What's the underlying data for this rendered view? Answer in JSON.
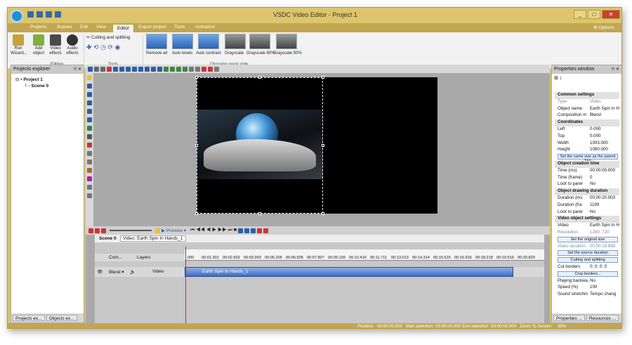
{
  "app": {
    "title": "VSDC Video Editor - Project 1"
  },
  "menu": {
    "items": [
      "Projects",
      "Scenes",
      "Edit",
      "View",
      "Editor",
      "Export project",
      "Tools",
      "Activation"
    ],
    "options": "Options"
  },
  "ribbon": {
    "run_wizard": "Run Wizard...",
    "add_object": "Add object",
    "video_effects": "Video effects",
    "audio_effects": "Audio effects",
    "editing_group": "Editing",
    "cutting": "Cutting and splitting",
    "tools_group": "Tools",
    "styles": [
      "Remove all",
      "Auto levels",
      "Auto contrast",
      "Grayscale",
      "Grayscale 80%",
      "Grayscale 50%"
    ],
    "quick_style_group": "Choosing quick style"
  },
  "projects_explorer": {
    "title": "Projects explorer",
    "project": "Project 1",
    "scene": "Scene 0",
    "tabs": [
      "Projects ex...",
      "Objects ex..."
    ]
  },
  "timeline": {
    "tabs": [
      "Scene 0",
      "Video: Earth Spin In Hands_1"
    ],
    "preview": "Preview",
    "headers": {
      "com": "Com...",
      "layers": "Layers"
    },
    "row": {
      "blend": "Blend",
      "type": "Video",
      "clip": "Earth Spin In Hands_1"
    },
    "ruler": [
      "000",
      "00:01.301",
      "00:02.602",
      "00:03.903",
      "00:05.205",
      "00:06.506",
      "00:07.807",
      "00:09.109",
      "00:10.410",
      "00:11.711",
      "00:13.013",
      "00:14.314",
      "00:15.615",
      "00:16.916",
      "00:18.218",
      "00:19.519",
      "00:20.820"
    ]
  },
  "properties": {
    "title": "Properties window",
    "rows": [
      {
        "k": "Common settings",
        "sec": true
      },
      {
        "k": "Type",
        "v": "Video",
        "gray": true
      },
      {
        "k": "Object name",
        "v": "Earth Spin In H"
      },
      {
        "k": "Composition m",
        "v": "Blend"
      },
      {
        "k": "Coordinates",
        "sec": true
      },
      {
        "k": "Left",
        "v": "0.000"
      },
      {
        "k": "Top",
        "v": "0.000"
      },
      {
        "k": "Width",
        "v": "1003.000"
      },
      {
        "k": "Height",
        "v": "1080.000"
      },
      {
        "btn": "Set the same size as the parent has"
      },
      {
        "k": "Object creation time",
        "sec": true
      },
      {
        "k": "Time (ms)",
        "v": "00:00:00.000"
      },
      {
        "k": "Time (frame)",
        "v": "0"
      },
      {
        "k": "Lock to parer",
        "v": "No"
      },
      {
        "k": "Object drawing duration",
        "sec": true
      },
      {
        "k": "Duration (ms",
        "v": "00:00:20.003"
      },
      {
        "k": "Duration (fra",
        "v": "1199"
      },
      {
        "k": "Lock to parer",
        "v": "No"
      },
      {
        "k": "Video object settings",
        "sec": true
      },
      {
        "k": "Video",
        "v": "Earth Spin In H"
      },
      {
        "k": "Resolution",
        "v": "1280; 720",
        "gray": true
      },
      {
        "btn": "Set the original size"
      },
      {
        "k": "Video duration",
        "v": "00:00:19.994",
        "gray": true
      },
      {
        "btn": "Set the source duration"
      },
      {
        "btn": "Cutting and splitting"
      },
      {
        "k": "Cut borders",
        "v": "0; 0; 0; 0"
      },
      {
        "btn": "Crop borders..."
      },
      {
        "k": "Playing backwa",
        "v": "No"
      },
      {
        "k": "Speed (%)",
        "v": "100"
      },
      {
        "k": "Sound stretchin",
        "v": "Tempo chang"
      }
    ],
    "tabs": [
      "Properties ...",
      "Resources ..."
    ]
  },
  "status": {
    "position_label": "Position:",
    "position": "00:00:00.000",
    "start_label": "Start selection:",
    "start": "00:00:00.000",
    "end_label": "End selection:",
    "end": "00:00:00.000",
    "zoom_label": "Zoom To Screen",
    "zoom": "35%"
  }
}
